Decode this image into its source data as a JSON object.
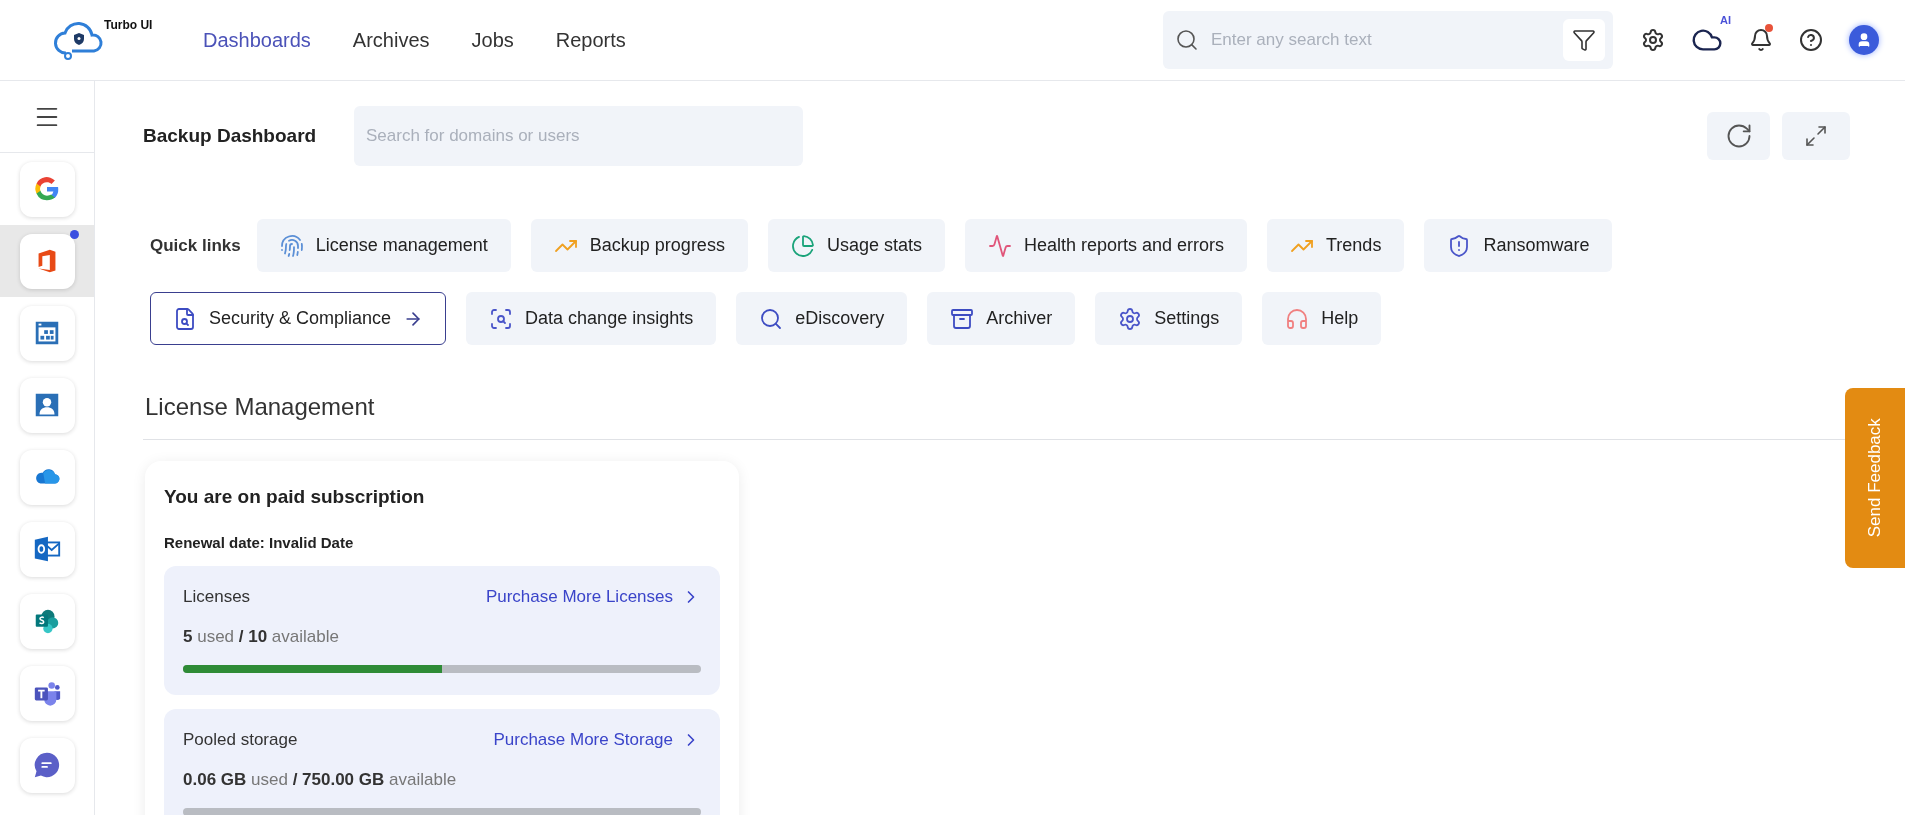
{
  "logo": {
    "text": "Turbo UI"
  },
  "nav": [
    {
      "label": "Dashboards",
      "selected": true
    },
    {
      "label": "Archives",
      "selected": false
    },
    {
      "label": "Jobs",
      "selected": false
    },
    {
      "label": "Reports",
      "selected": false
    }
  ],
  "global_search": {
    "placeholder": "Enter any search text"
  },
  "ai_badge": "AI",
  "notifications": {
    "unread": true
  },
  "sidebar": {
    "apps": [
      {
        "selected": false,
        "notification": false
      },
      {
        "selected": true,
        "notification": true
      },
      {
        "selected": false,
        "notification": false
      },
      {
        "selected": false,
        "notification": false
      },
      {
        "selected": false,
        "notification": false
      },
      {
        "selected": false,
        "notification": false
      },
      {
        "selected": false,
        "notification": false
      },
      {
        "selected": false,
        "notification": false
      },
      {
        "selected": false,
        "notification": false
      }
    ]
  },
  "page": {
    "title": "Backup Dashboard",
    "search": {
      "placeholder": "Search for domains or users"
    }
  },
  "quick_links": {
    "label": "Quick links",
    "items": [
      {
        "label": "License management",
        "selected": false
      },
      {
        "label": "Backup progress",
        "selected": false
      },
      {
        "label": "Usage stats",
        "selected": false
      },
      {
        "label": "Health reports and errors",
        "selected": false
      },
      {
        "label": "Trends",
        "selected": false
      },
      {
        "label": "Ransomware",
        "selected": false
      },
      {
        "label": "Security & Compliance",
        "selected": true
      },
      {
        "label": "Data change insights",
        "selected": false
      },
      {
        "label": "eDiscovery",
        "selected": false
      },
      {
        "label": "Archiver",
        "selected": false
      },
      {
        "label": "Settings",
        "selected": false
      },
      {
        "label": "Help",
        "selected": false
      }
    ]
  },
  "section": {
    "title": "License Management"
  },
  "subscription_card": {
    "title": "You are on paid subscription",
    "renewal": "Renewal date: Invalid Date",
    "meters": [
      {
        "name": "Licenses",
        "link": "Purchase More Licenses",
        "usage": "**5** used **/ 10** available",
        "level": 0.5
      },
      {
        "name": "Pooled storage",
        "link": "Purchase More Storage",
        "usage": "**0.06 GB** used **/ 750.00 GB** available",
        "level": 0
      }
    ]
  },
  "feedback_tab": "Send Feedback"
}
